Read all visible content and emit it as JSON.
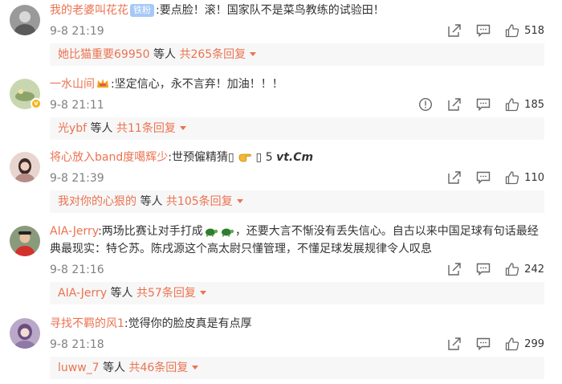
{
  "comments": [
    {
      "username": "我的老婆叫花花",
      "fan_badge": "铁粉",
      "text": ":要点脸！滚！国家队不是菜鸟教练的试验田！",
      "time": "9-8 21:19",
      "likes": "518",
      "reply_user": "她比猫重要69950",
      "reply_mid": " 等人 ",
      "reply_count": "共265条回复"
    },
    {
      "username": "一水山间",
      "text": ":坚定信心，永不言弃！加油！！！",
      "time": "9-8 21:11",
      "likes": "185",
      "verified_mark": "v",
      "reply_user": "光ybf",
      "reply_mid": " 等人 ",
      "reply_count": "共11条回复"
    },
    {
      "username": "将心放入band度噶辉少",
      "text": ":世预僱精猜▯ ",
      "text_tail_box": " ▯ ",
      "text_tail": "5",
      "text_mark": "vt.Cm",
      "time": "9-8 21:39",
      "likes": "110",
      "reply_user": "我对你的心狠的",
      "reply_mid": " 等人 ",
      "reply_count": "共105条回复"
    },
    {
      "username": "AIA-Jerry",
      "text_a": ":两场比赛让对手打成",
      "text_b": "，还要大言不惭没有丢失信心。自古以来中国足球有句话最经典最现实：特仑苏。陈戌源这个高太尉只懂管理，不懂足球发展规律令人叹息",
      "time": "9-8 21:16",
      "likes": "242",
      "reply_user": "AIA-Jerry",
      "reply_mid": " 等人 ",
      "reply_count": "共57条回复"
    },
    {
      "username": "寻找不羁的风1",
      "text": ":觉得你的脸皮真是有点厚",
      "time": "9-8 21:18",
      "likes": "299",
      "reply_user": "luww_7",
      "reply_mid": " 等人 ",
      "reply_count": "共46条回复"
    }
  ],
  "icons": {
    "share": "share-icon",
    "comment": "comment-icon",
    "like": "thumbs-up-icon",
    "report": "report-icon"
  },
  "colors": {
    "username": "#eb7350",
    "time": "#808080",
    "reply_bg": "#f7f7f7",
    "fan_badge": "#a5c8f5"
  }
}
